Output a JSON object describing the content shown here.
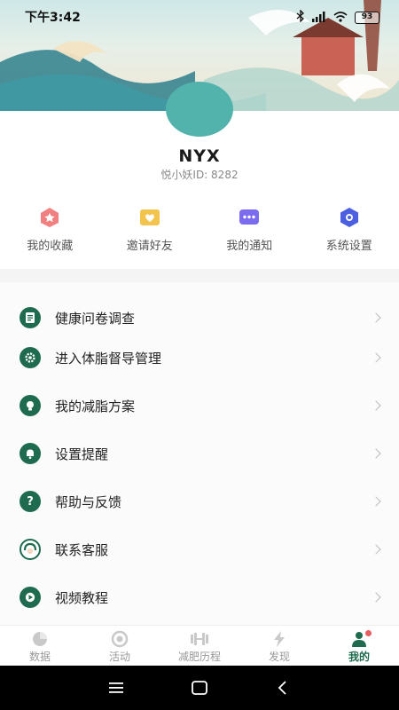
{
  "status": {
    "time": "下午3:42",
    "battery": "93"
  },
  "profile": {
    "name": "NYX",
    "id_line": "悦小妖ID: 8282"
  },
  "quick_actions": [
    {
      "label": "我的收藏",
      "icon": "star-icon",
      "color": "#ef6b6b"
    },
    {
      "label": "邀请好友",
      "icon": "heart-envelope-icon",
      "color": "#f2c44e"
    },
    {
      "label": "我的通知",
      "icon": "message-dots-icon",
      "color": "#7b6bef"
    },
    {
      "label": "系统设置",
      "icon": "settings-hex-icon",
      "color": "#4b5fe0"
    }
  ],
  "menu": [
    {
      "label": "健康问卷调查",
      "icon": "questionnaire-icon"
    },
    {
      "label": "进入体脂督导管理",
      "icon": "settings-gear-icon"
    },
    {
      "label": "我的减脂方案",
      "icon": "bulb-icon"
    },
    {
      "label": "设置提醒",
      "icon": "bell-icon"
    },
    {
      "label": "帮助与反馈",
      "icon": "question-icon"
    },
    {
      "label": "联系客服",
      "icon": "headset-icon"
    },
    {
      "label": "视频教程",
      "icon": "play-icon"
    }
  ],
  "tabs": [
    {
      "label": "数据",
      "icon": "pie-chart-icon"
    },
    {
      "label": "活动",
      "icon": "target-icon"
    },
    {
      "label": "减肥历程",
      "icon": "dumbbell-icon"
    },
    {
      "label": "发现",
      "icon": "lightning-icon"
    },
    {
      "label": "我的",
      "icon": "user-icon"
    }
  ],
  "active_tab": "我的",
  "colors": {
    "accent": "#1f6b4f",
    "avatar": "#52b3ad"
  }
}
